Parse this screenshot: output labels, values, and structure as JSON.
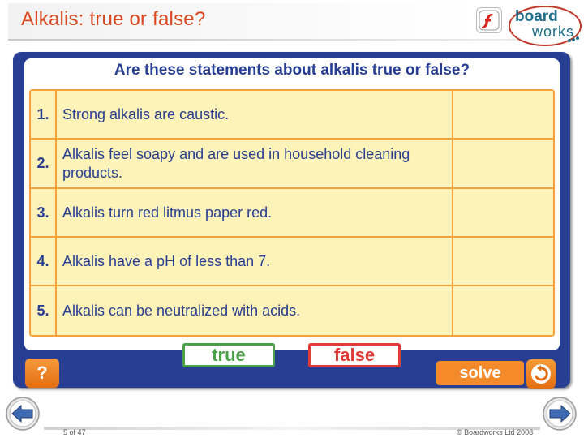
{
  "header": {
    "title": "Alkalis: true or false?",
    "logo_board": "board",
    "logo_works": "works"
  },
  "activity": {
    "question": "Are these statements about alkalis true or false?",
    "statements": [
      {
        "num": "1.",
        "text": "Strong alkalis are caustic."
      },
      {
        "num": "2.",
        "text": "Alkalis feel soapy and are used in household cleaning products."
      },
      {
        "num": "3.",
        "text": "Alkalis turn red litmus paper red."
      },
      {
        "num": "4.",
        "text": "Alkalis have a pH of less than 7."
      },
      {
        "num": "5.",
        "text": "Alkalis can be neutralized with acids."
      }
    ],
    "true_label": "true",
    "false_label": "false",
    "help_label": "?",
    "solve_label": "solve"
  },
  "footer": {
    "slide_number": "5 of 47",
    "copyright": "© Boardworks Ltd 2008"
  },
  "colors": {
    "title": "#d9461d",
    "panel": "#283e92",
    "statement_bg": "#fdf2b8",
    "statement_border": "#f4a13b",
    "true": "#4aa046",
    "false": "#e23a37",
    "accent": "#f58a2a"
  },
  "icons": [
    "flash-icon",
    "boardworks-logo",
    "help-icon",
    "undo-icon",
    "prev-arrow-icon",
    "next-arrow-icon"
  ]
}
